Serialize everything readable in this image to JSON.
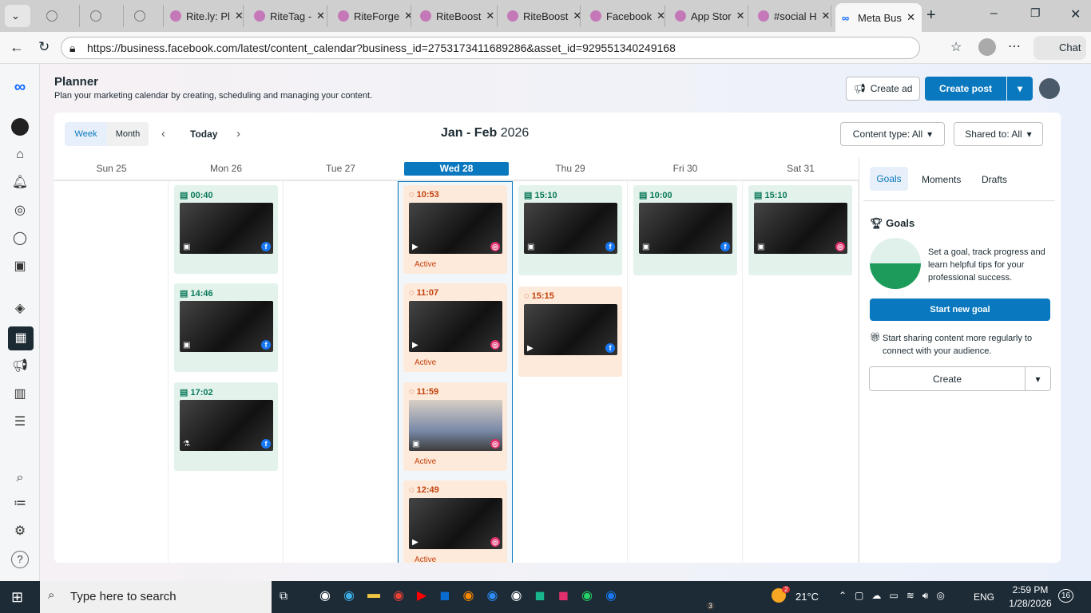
{
  "browser": {
    "tabs": [
      "",
      "",
      "",
      "Rite.ly: Pl",
      "RiteTag -",
      "RiteForge",
      "RiteBoost",
      "RiteBoost",
      "Facebook",
      "App Stor",
      "#social H",
      "Meta Bus"
    ],
    "url": "https://business.facebook.com/latest/content_calendar?business_id=2753173411689286&asset_id=929551340249168",
    "chat": "Chat"
  },
  "header": {
    "title": "Planner",
    "subtitle": "Plan your marketing calendar by creating, scheduling and managing your content.",
    "create_ad": "Create ad",
    "create_post": "Create post"
  },
  "toolbar": {
    "week": "Week",
    "month": "Month",
    "today": "Today",
    "range": "Jan - Feb",
    "year": "2026",
    "content_type": "Content type: All",
    "shared_to": "Shared to: All"
  },
  "days": [
    "Sun 25",
    "Mon 26",
    "Tue 27",
    "Wed 28",
    "Thu 29",
    "Fri 30",
    "Sat 31"
  ],
  "posts": [
    {
      "day": 1,
      "slot": 0,
      "time": "00:40",
      "state": "scheduled",
      "net": "facebook",
      "kind": "image"
    },
    {
      "day": 1,
      "slot": 1,
      "time": "14:46",
      "state": "scheduled",
      "net": "facebook",
      "kind": "image"
    },
    {
      "day": 1,
      "slot": 2,
      "time": "17:02",
      "state": "scheduled",
      "net": "facebook",
      "kind": "test"
    },
    {
      "day": 3,
      "slot": 0,
      "time": "10:53",
      "state": "active",
      "status": "Active",
      "net": "instagram",
      "kind": "video"
    },
    {
      "day": 3,
      "slot": 1,
      "time": "11:07",
      "state": "active",
      "status": "Active",
      "net": "instagram",
      "kind": "video"
    },
    {
      "day": 3,
      "slot": 2,
      "time": "11:59",
      "state": "active",
      "status": "Active",
      "net": "instagram",
      "kind": "image"
    },
    {
      "day": 3,
      "slot": 3,
      "time": "12:49",
      "state": "active",
      "status": "Active",
      "net": "instagram",
      "kind": "video"
    },
    {
      "day": 4,
      "slot": 0,
      "time": "15:10",
      "state": "scheduled",
      "net": "facebook",
      "kind": "image"
    },
    {
      "day": 4,
      "slot": 1,
      "time": "15:15",
      "state": "active",
      "net": "facebook",
      "kind": "video"
    },
    {
      "day": 5,
      "slot": 0,
      "time": "10:00",
      "state": "scheduled",
      "net": "facebook",
      "kind": "reel"
    },
    {
      "day": 6,
      "slot": 0,
      "time": "15:10",
      "state": "scheduled",
      "net": "instagram",
      "kind": "image"
    }
  ],
  "panel": {
    "tabs": [
      "Goals",
      "Moments",
      "Drafts"
    ],
    "heading": "Goals",
    "desc": "Set a goal, track progress and learn helpful tips for your professional success.",
    "start_goal": "Start new goal",
    "tip": "Start sharing content more regularly to connect with your audience.",
    "create": "Create"
  },
  "taskbar": {
    "search": "Type here to search",
    "weather": "21°C",
    "lang": "ENG",
    "time": "2:59 PM",
    "date": "1/28/2026",
    "notifications": "16",
    "weather_badge": "2",
    "whatsapp_badge": "3"
  },
  "colors": {
    "accent": "#0a78be",
    "scheduled_bg": "#e3f3ec",
    "active_bg": "#fdeadb"
  }
}
